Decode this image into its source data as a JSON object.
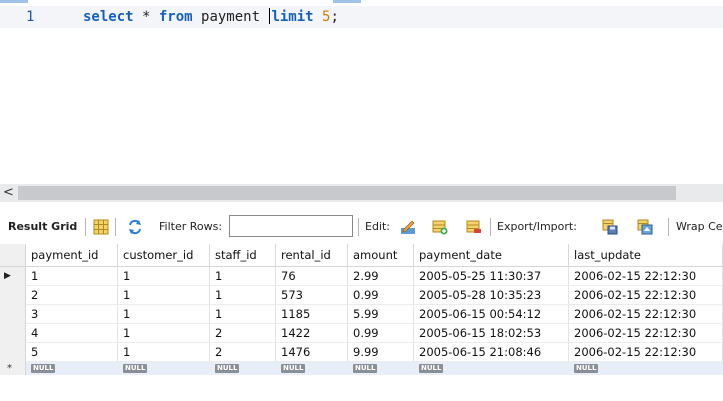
{
  "editor": {
    "line_number": "1",
    "sql": {
      "select": "select",
      "star": " * ",
      "from": "from",
      "table": " payment ",
      "limit": "limit",
      "space": " ",
      "count": "5",
      "semicolon": ";"
    },
    "colors": {
      "keyword": "#1560bd",
      "number": "#d27a00"
    }
  },
  "scrollbar": {
    "left_arrow": "<"
  },
  "toolbar": {
    "result_grid": "Result Grid",
    "filter_rows": "Filter Rows:",
    "filter_value": "",
    "edit": "Edit:",
    "export_import": "Export/Import:",
    "wrap_cell": "Wrap Ce"
  },
  "grid": {
    "columns": [
      "payment_id",
      "customer_id",
      "staff_id",
      "rental_id",
      "amount",
      "payment_date",
      "last_update"
    ],
    "rows": [
      [
        "1",
        "1",
        "1",
        "76",
        "2.99",
        "2005-05-25 11:30:37",
        "2006-02-15 22:12:30"
      ],
      [
        "2",
        "1",
        "1",
        "573",
        "0.99",
        "2005-05-28 10:35:23",
        "2006-02-15 22:12:30"
      ],
      [
        "3",
        "1",
        "1",
        "1185",
        "5.99",
        "2005-06-15 00:54:12",
        "2006-02-15 22:12:30"
      ],
      [
        "4",
        "1",
        "2",
        "1422",
        "0.99",
        "2005-06-15 18:02:53",
        "2006-02-15 22:12:30"
      ],
      [
        "5",
        "1",
        "2",
        "1476",
        "9.99",
        "2005-06-15 21:08:46",
        "2006-02-15 22:12:30"
      ]
    ],
    "null_label": "NULL",
    "current_row_marker": "▶",
    "new_row_marker": "*"
  }
}
